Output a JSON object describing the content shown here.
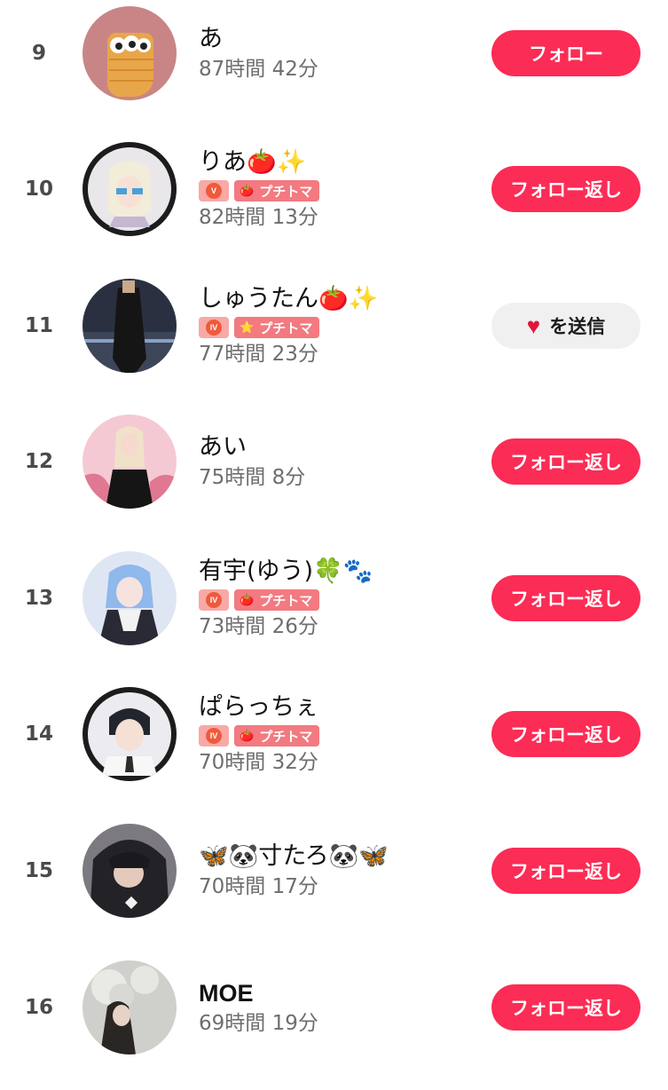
{
  "rows": [
    {
      "rank": "9",
      "name": "あ",
      "badges": false,
      "time": "87時間 42分",
      "button": "フォロー",
      "avatar": "a9"
    },
    {
      "rank": "10",
      "name": "りあ🍅✨",
      "badges": true,
      "lv": "V",
      "tag": "プチトマ",
      "tag_icon": "🍅",
      "time": "82時間 13分",
      "button": "フォロー返し",
      "avatar": "a10"
    },
    {
      "rank": "11",
      "name": "しゅうたん🍅✨",
      "badges": true,
      "lv": "IV",
      "tag": "プチトマ",
      "tag_icon": "⭐",
      "time": "77時間 23分",
      "button": "を送信",
      "button_style": "gray",
      "avatar": "a11"
    },
    {
      "rank": "12",
      "name": "あい",
      "badges": false,
      "time": "75時間 8分",
      "button": "フォロー返し",
      "avatar": "a12"
    },
    {
      "rank": "13",
      "name": "有宇(ゆう)🍀🐾",
      "badges": true,
      "lv": "IV",
      "tag": "プチトマ",
      "tag_icon": "🍅",
      "time": "73時間 26分",
      "button": "フォロー返し",
      "avatar": "a13"
    },
    {
      "rank": "14",
      "name": "ぱらっちぇ",
      "badges": true,
      "lv": "IV",
      "tag": "プチトマ",
      "tag_icon": "🍅",
      "time": "70時間 32分",
      "button": "フォロー返し",
      "avatar": "a14"
    },
    {
      "rank": "15",
      "name": "🦋🐼寸たろ🐼🦋",
      "badges": false,
      "time": "70時間 17分",
      "button": "フォロー返し",
      "avatar": "a15"
    },
    {
      "rank": "16",
      "name": "MOE",
      "badges": false,
      "time": "69時間 19分",
      "button": "フォロー返し",
      "avatar": "a16"
    }
  ],
  "colors": {
    "accent": "#fb2c55",
    "badge": "#f27a80"
  }
}
